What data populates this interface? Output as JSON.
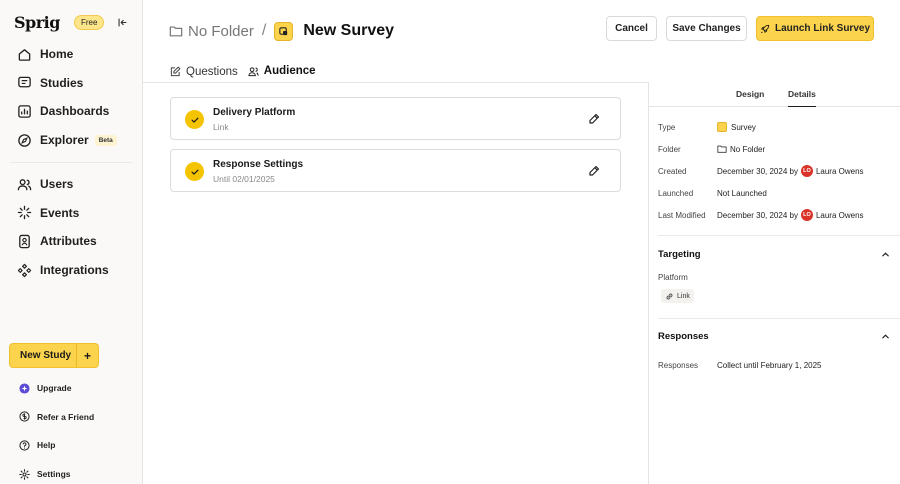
{
  "sidebar": {
    "logo": "Sprig",
    "plan_badge": "Free",
    "nav": [
      {
        "label": "Home",
        "icon": "home-icon"
      },
      {
        "label": "Studies",
        "icon": "studies-icon"
      },
      {
        "label": "Dashboards",
        "icon": "dashboards-icon"
      },
      {
        "label": "Explorer",
        "icon": "explorer-icon",
        "badge": "Beta"
      }
    ],
    "nav2": [
      {
        "label": "Users",
        "icon": "users-icon"
      },
      {
        "label": "Events",
        "icon": "events-icon"
      },
      {
        "label": "Attributes",
        "icon": "attributes-icon"
      },
      {
        "label": "Integrations",
        "icon": "integrations-icon"
      }
    ],
    "new_study": "New Study",
    "new_study_plus": "+",
    "bottom": [
      {
        "label": "Upgrade",
        "icon": "upgrade-icon"
      },
      {
        "label": "Refer a Friend",
        "icon": "refer-icon"
      },
      {
        "label": "Help",
        "icon": "help-icon"
      },
      {
        "label": "Settings",
        "icon": "settings-icon"
      }
    ]
  },
  "header": {
    "folder": "No Folder",
    "separator": "/",
    "title": "New Survey",
    "cancel": "Cancel",
    "save": "Save Changes",
    "launch": "Launch Link Survey"
  },
  "tabs": {
    "questions": "Questions",
    "audience": "Audience"
  },
  "cards": [
    {
      "title": "Delivery Platform",
      "subtitle": "Link"
    },
    {
      "title": "Response Settings",
      "subtitle": "Until 02/01/2025"
    }
  ],
  "panel": {
    "tabs": {
      "design": "Design",
      "details": "Details"
    },
    "details": {
      "type_label": "Type",
      "type_value": "Survey",
      "folder_label": "Folder",
      "folder_value": "No Folder",
      "created_label": "Created",
      "created_value": "December 30, 2024 by",
      "created_initials": "LO",
      "created_user": "Laura Owens",
      "launched_label": "Launched",
      "launched_value": "Not Launched",
      "modified_label": "Last Modified",
      "modified_value": "December 30, 2024 by",
      "modified_initials": "LO",
      "modified_user": "Laura Owens"
    },
    "targeting": {
      "title": "Targeting",
      "platform_label": "Platform",
      "platform_value": "Link"
    },
    "responses": {
      "title": "Responses",
      "label": "Responses",
      "value": "Collect until February 1, 2025"
    }
  },
  "colors": {
    "accent": "#fcd34d",
    "check": "#f5c400",
    "avatar": "#d9332a"
  }
}
